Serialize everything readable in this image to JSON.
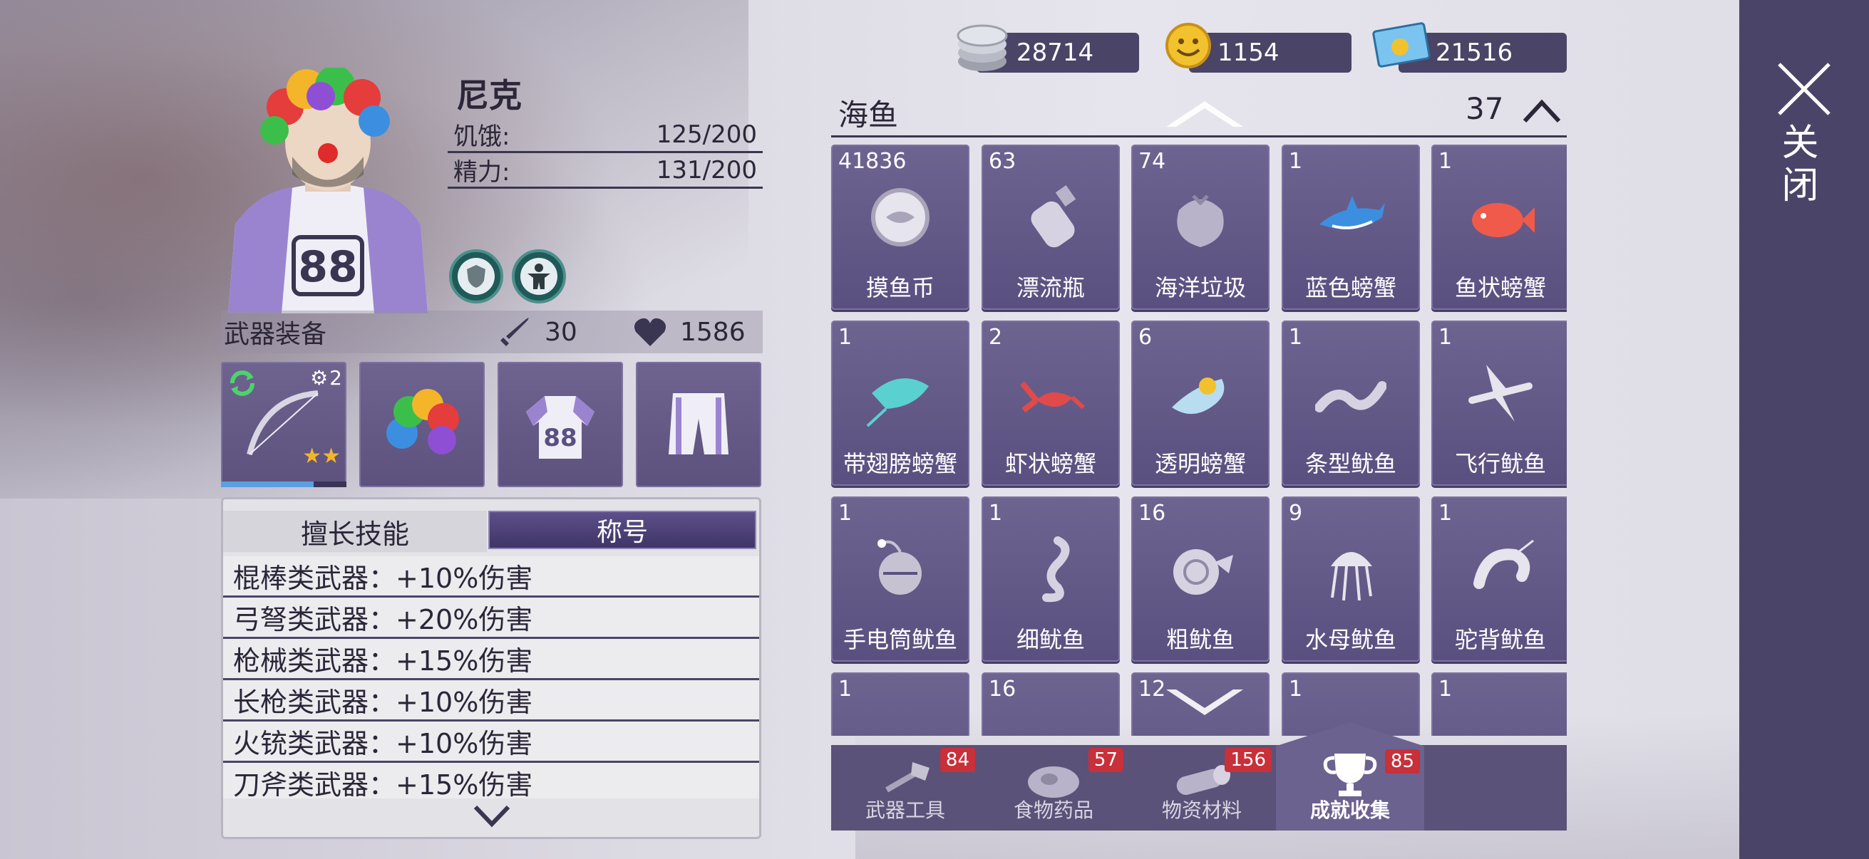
{
  "character": {
    "name": "尼克",
    "stats": [
      {
        "label": "饥饿:",
        "value": "125/200"
      },
      {
        "label": "精力:",
        "value": "131/200"
      }
    ],
    "equipment_title": "武器装备",
    "attack": "30",
    "health": "1586",
    "weapon_gear_level": "2"
  },
  "skills": {
    "tab_skills": "擅长技能",
    "tab_titles": "称号",
    "rows": [
      "棍棒类武器：+10%伤害",
      "弓弩类武器：+20%伤害",
      "枪械类武器：+15%伤害",
      "长枪类武器：+10%伤害",
      "火铳类武器：+10%伤害",
      "刀斧类武器：+15%伤害"
    ]
  },
  "currency": {
    "silver": "28714",
    "gold": "1154",
    "ticket": "21516"
  },
  "inventory": {
    "title": "海鱼",
    "count": "37",
    "items": [
      {
        "count": "41836",
        "label": "摸鱼币",
        "icon": "coin-icon"
      },
      {
        "count": "63",
        "label": "漂流瓶",
        "icon": "bottle-icon"
      },
      {
        "count": "74",
        "label": "海洋垃圾",
        "icon": "trash-bag-icon"
      },
      {
        "count": "1",
        "label": "蓝色螃蟹",
        "icon": "shark-icon"
      },
      {
        "count": "1",
        "label": "鱼状螃蟹",
        "icon": "red-fish-icon"
      },
      {
        "count": "1",
        "label": "带翅膀螃蟹",
        "icon": "stingray-icon"
      },
      {
        "count": "2",
        "label": "虾状螃蟹",
        "icon": "lobster-icon"
      },
      {
        "count": "6",
        "label": "透明螃蟹",
        "icon": "clear-fish-icon"
      },
      {
        "count": "1",
        "label": "条型鱿鱼",
        "icon": "eel-icon"
      },
      {
        "count": "1",
        "label": "飞行鱿鱼",
        "icon": "flying-fish-icon"
      },
      {
        "count": "1",
        "label": "手电筒鱿鱼",
        "icon": "anglerfish-icon"
      },
      {
        "count": "1",
        "label": "细鱿鱼",
        "icon": "seahorse-icon"
      },
      {
        "count": "16",
        "label": "粗鱿鱼",
        "icon": "nautilus-icon"
      },
      {
        "count": "9",
        "label": "水母鱿鱼",
        "icon": "jellyfish-icon"
      },
      {
        "count": "1",
        "label": "驼背鱿鱼",
        "icon": "shrimp-icon"
      },
      {
        "count": "1",
        "label": "",
        "icon": "crab-icon"
      },
      {
        "count": "16",
        "label": "",
        "icon": "shell-icon"
      },
      {
        "count": "12",
        "label": "",
        "icon": "fish-icon"
      },
      {
        "count": "1",
        "label": "",
        "icon": "fish-icon"
      },
      {
        "count": "1",
        "label": "",
        "icon": "fish-icon"
      }
    ]
  },
  "tabs": [
    {
      "label": "武器工具",
      "badge": "84",
      "icon": "axe-icon"
    },
    {
      "label": "食物药品",
      "badge": "57",
      "icon": "meat-icon"
    },
    {
      "label": "物资材料",
      "badge": "156",
      "icon": "log-icon"
    },
    {
      "label": "成就收集",
      "badge": "85",
      "icon": "trophy-icon"
    }
  ],
  "close_label": "关闭"
}
